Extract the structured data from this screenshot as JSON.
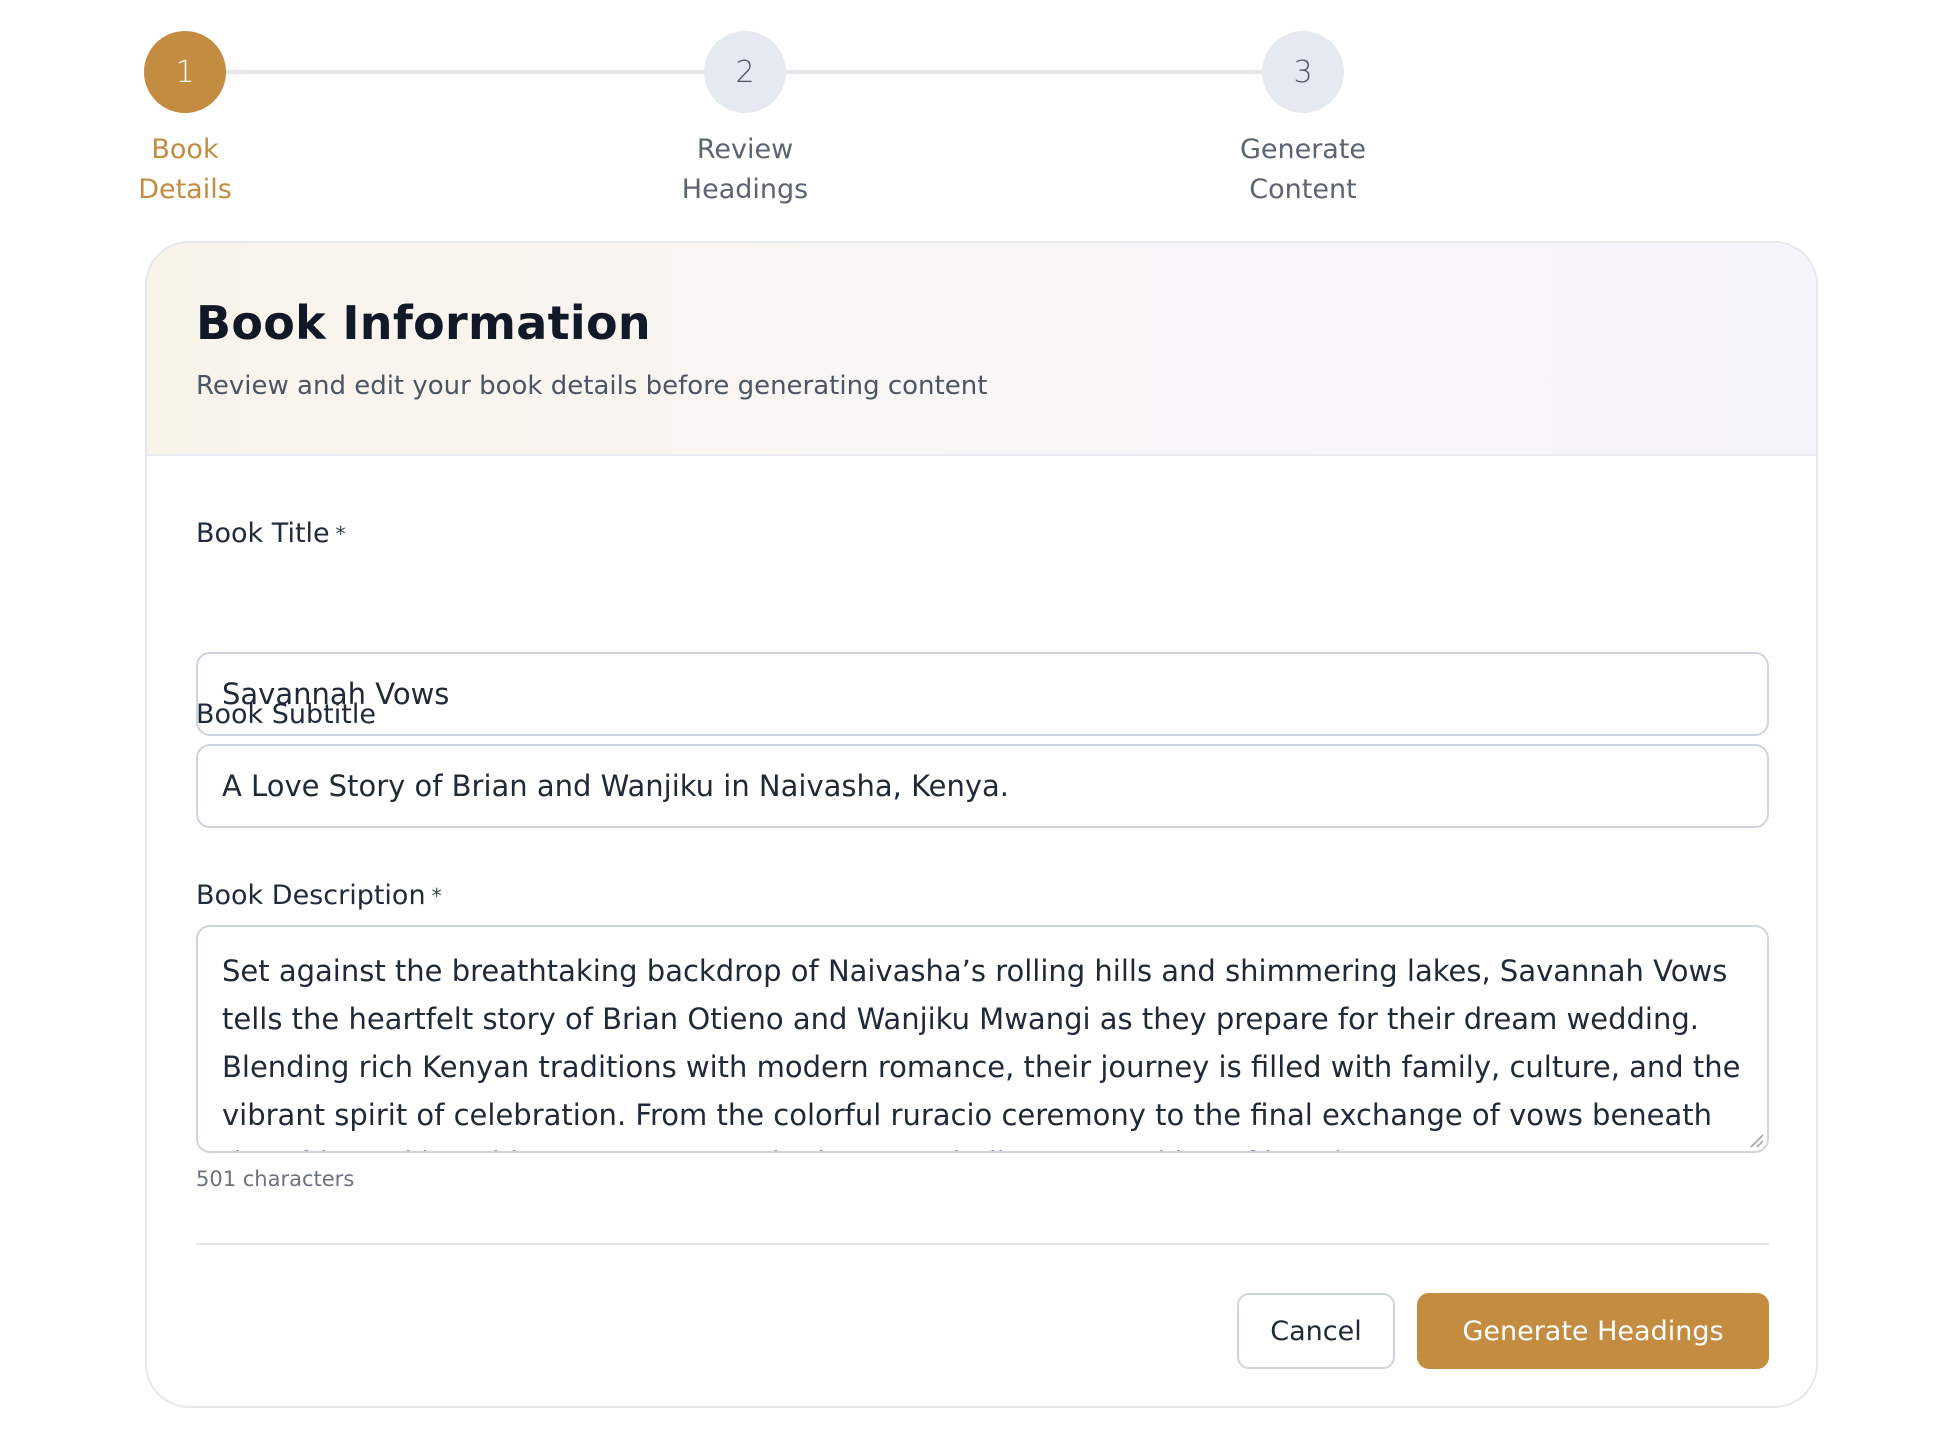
{
  "stepper": {
    "steps": [
      {
        "number": "1",
        "line1": "Book",
        "line2": "Details",
        "state": "active"
      },
      {
        "number": "2",
        "line1": "Review",
        "line2": "Headings",
        "state": "pending"
      },
      {
        "number": "3",
        "line1": "Generate",
        "line2": "Content",
        "state": "pending"
      }
    ]
  },
  "card": {
    "title": "Book Information",
    "subtitle": "Review and edit your book details before generating content"
  },
  "form": {
    "title_label": "Book Title",
    "title_required": "*",
    "title_value": "Savannah Vows",
    "subtitle_label": "Book Subtitle",
    "subtitle_value": "A Love Story of Brian and Wanjiku in Naivasha, Kenya.",
    "description_label": "Book Description",
    "description_required": "*",
    "description_value": "Set against the breathtaking backdrop of Naivasha’s rolling hills and shimmering lakes, Savannah Vows tells the heartfelt story of Brian Otieno and Wanjiku Mwangi as they prepare for their dream wedding. Blending rich Kenyan traditions with modern romance, their journey is filled with family, culture, and the vibrant spirit of celebration. From the colorful ruracio ceremony to the final exchange of vows beneath the African skies, this story captures the beauty, challenges, and joy of love in Kenya.",
    "char_count": "501 characters"
  },
  "actions": {
    "cancel_label": "Cancel",
    "primary_label": "Generate Headings"
  },
  "colors": {
    "accent": "#c38c40",
    "pending_step_bg": "#e5e9f1",
    "border": "#cfd5de"
  }
}
